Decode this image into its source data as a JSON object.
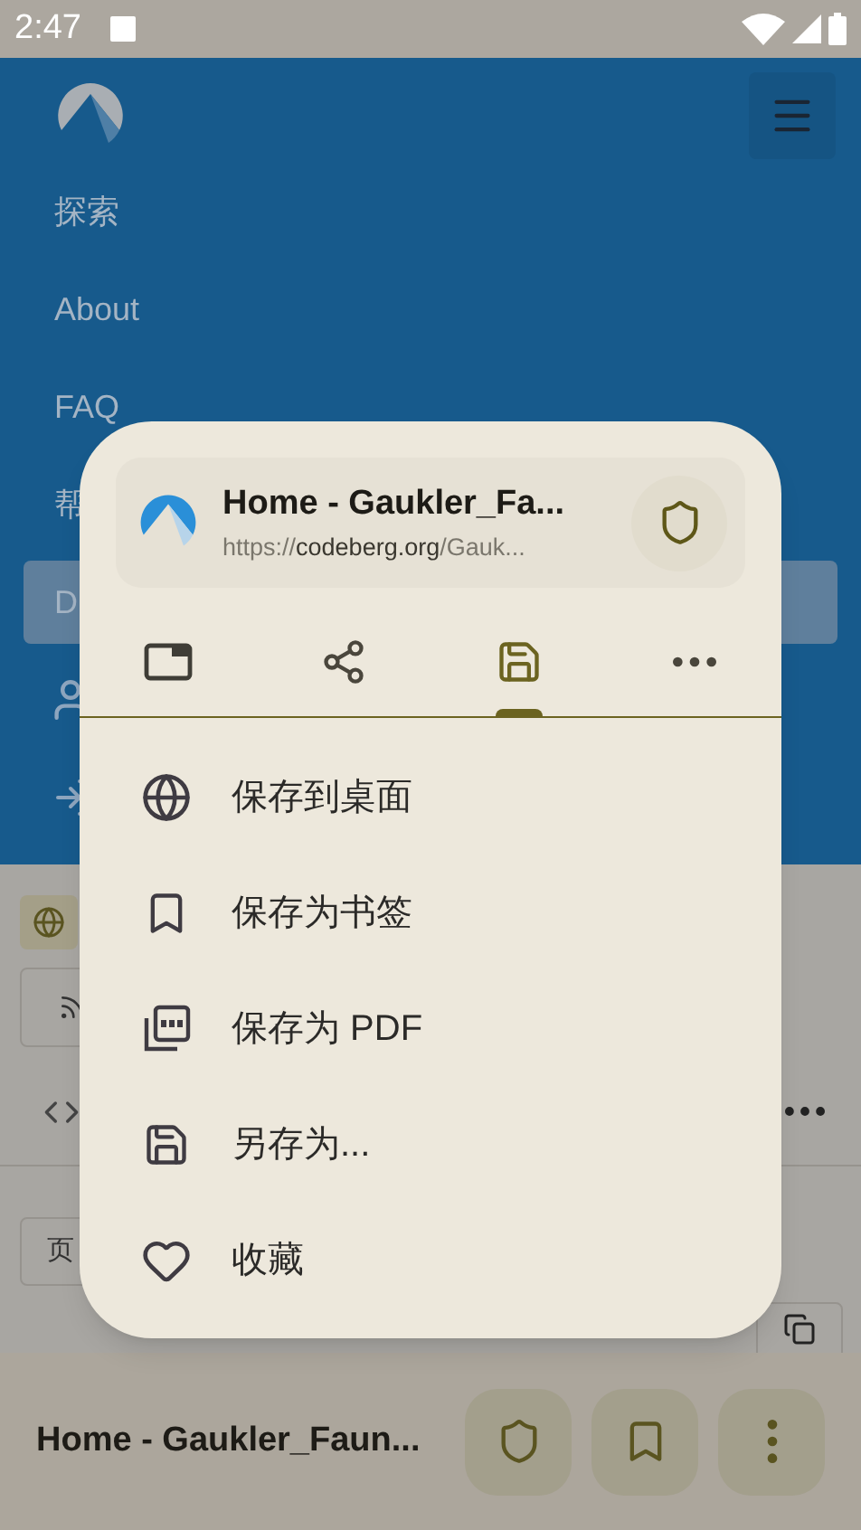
{
  "status_bar": {
    "time": "2:47"
  },
  "nav": {
    "items": [
      {
        "kind": "text",
        "label": "探索",
        "selected": false
      },
      {
        "kind": "text",
        "label": "About",
        "selected": false
      },
      {
        "kind": "text",
        "label": "FAQ",
        "selected": false
      },
      {
        "kind": "text",
        "label": "帮",
        "selected": false
      },
      {
        "kind": "text",
        "label": "D",
        "selected": true
      },
      {
        "kind": "user",
        "selected": false
      },
      {
        "kind": "sign-in",
        "selected": false
      }
    ]
  },
  "page_behind": {
    "page_label": "页"
  },
  "bottom_bar": {
    "title": "Home - Gaukler_Faun..."
  },
  "dialog": {
    "title": "Home - Gaukler_Fa...",
    "url": {
      "scheme": "https://",
      "host": "codeberg.org",
      "path": "/Gauk..."
    },
    "tabs": [
      {
        "kind": "tabs",
        "selected": false
      },
      {
        "kind": "share",
        "selected": false
      },
      {
        "kind": "save",
        "selected": true
      },
      {
        "kind": "more",
        "selected": false
      }
    ],
    "items": [
      {
        "kind": "globe",
        "label": "保存到桌面"
      },
      {
        "kind": "bookmark",
        "label": "保存为书签"
      },
      {
        "kind": "pdf",
        "label": "保存为 PDF"
      },
      {
        "kind": "save",
        "label": "另存为..."
      },
      {
        "kind": "heart",
        "label": "收藏"
      }
    ]
  }
}
